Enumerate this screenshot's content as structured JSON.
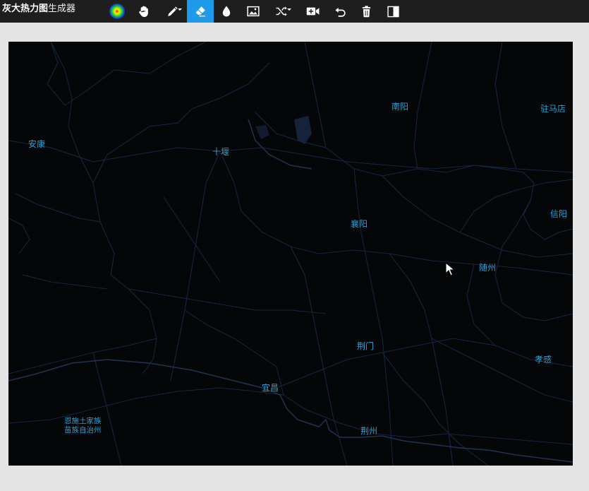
{
  "app": {
    "title_bold": "灰大热力图",
    "title_rest": "生成器"
  },
  "toolbar": {
    "tools": [
      {
        "name": "gradient-tool",
        "icon": "color-gradient-icon"
      },
      {
        "name": "pan-tool",
        "icon": "hand-icon"
      },
      {
        "name": "brush-tool",
        "icon": "pencil-icon",
        "has_dropdown": true
      },
      {
        "name": "eraser-tool",
        "icon": "eraser-icon",
        "active": true
      },
      {
        "name": "opacity-tool",
        "icon": "droplet-icon"
      },
      {
        "name": "image-tool",
        "icon": "image-icon"
      },
      {
        "name": "random-tool",
        "icon": "shuffle-icon",
        "has_dropdown": true
      },
      {
        "name": "record-tool",
        "icon": "video-add-icon"
      },
      {
        "name": "undo-tool",
        "icon": "undo-icon"
      },
      {
        "name": "delete-tool",
        "icon": "trash-icon"
      },
      {
        "name": "compare-tool",
        "icon": "split-view-icon"
      }
    ],
    "active_color": "#1e9be9"
  },
  "map": {
    "background": "#050608",
    "label_color": "#2aa4d8",
    "road_color": "#1b2a4a",
    "cities": [
      {
        "id": "nanyang",
        "label": "南阳"
      },
      {
        "id": "zhumadian",
        "label": "驻马店"
      },
      {
        "id": "ankang",
        "label": "安康"
      },
      {
        "id": "shiyan",
        "label": "十堰"
      },
      {
        "id": "xiangyang",
        "label": "襄阳"
      },
      {
        "id": "xinyang",
        "label": "信阳"
      },
      {
        "id": "suizhou",
        "label": "随州"
      },
      {
        "id": "jingmen",
        "label": "荆门"
      },
      {
        "id": "xiaogan",
        "label": "孝感"
      },
      {
        "id": "yichang",
        "label": "宜昌"
      },
      {
        "id": "jingzhou",
        "label": "荆州"
      },
      {
        "id": "enshi_l1",
        "label": "恩施土家族"
      },
      {
        "id": "enshi_l2",
        "label": "苗族自治州"
      }
    ]
  }
}
